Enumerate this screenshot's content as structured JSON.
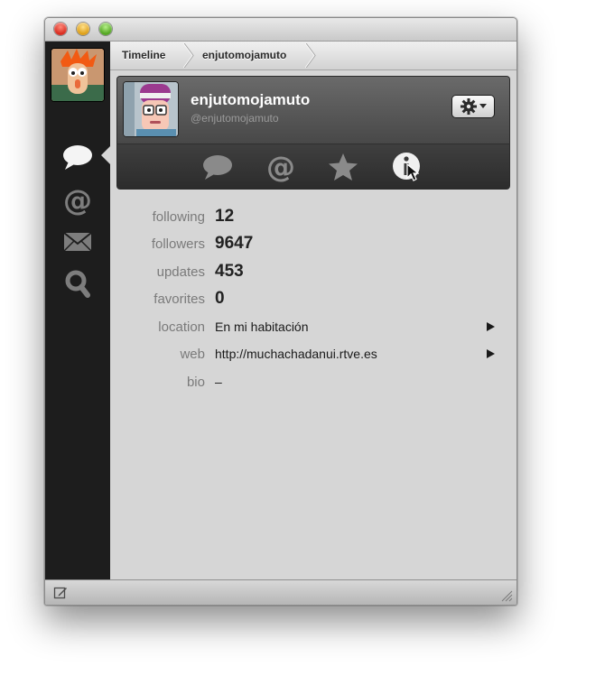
{
  "window": {
    "controls": [
      "close-button",
      "minimize-button",
      "zoom-button"
    ]
  },
  "sidebar": {
    "items": [
      {
        "id": "timeline",
        "icon": "speech-bubble-icon",
        "active": true
      },
      {
        "id": "mentions",
        "icon": "at-sign-icon",
        "active": false
      },
      {
        "id": "messages",
        "icon": "envelope-icon",
        "active": false
      },
      {
        "id": "search",
        "icon": "search-icon",
        "active": false
      }
    ]
  },
  "breadcrumb": {
    "items": [
      "Timeline",
      "enjutomojamuto"
    ]
  },
  "profile": {
    "name": "enjutomojamuto",
    "handle": "@enjutomojamuto",
    "tabs": [
      {
        "id": "tweets",
        "icon": "speech-bubble-icon"
      },
      {
        "id": "mentions",
        "icon": "at-sign-icon"
      },
      {
        "id": "favorites",
        "icon": "star-icon"
      },
      {
        "id": "info",
        "icon": "info-icon",
        "active": true
      }
    ]
  },
  "stats": {
    "following": {
      "label": "following",
      "value": "12"
    },
    "followers": {
      "label": "followers",
      "value": "9647"
    },
    "updates": {
      "label": "updates",
      "value": "453"
    },
    "favorites": {
      "label": "favorites",
      "value": "0"
    },
    "location": {
      "label": "location",
      "value": "En mi habitación"
    },
    "web": {
      "label": "web",
      "value": "http://muchachadanui.rtve.es"
    },
    "bio": {
      "label": "bio",
      "value": "–"
    }
  },
  "colors": {
    "sidebar_bg": "#1d1d1d",
    "content_bg": "#d6d6d6",
    "header_bg": "#4a4a4a"
  }
}
